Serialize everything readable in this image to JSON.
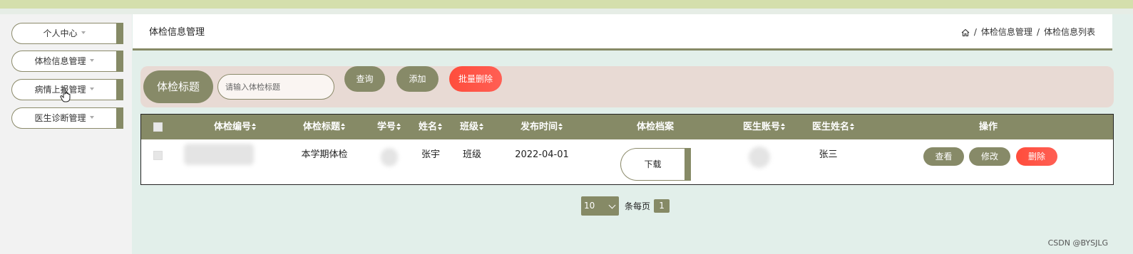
{
  "sidebar": {
    "items": [
      {
        "label": "个人中心"
      },
      {
        "label": "体检信息管理"
      },
      {
        "label": "病情上报管理"
      },
      {
        "label": "医生诊断管理"
      }
    ]
  },
  "header": {
    "title": "体检信息管理",
    "breadcrumb": [
      "体检信息管理",
      "体检信息列表"
    ],
    "breadcrumb_sep": "/"
  },
  "search": {
    "label": "体检标题",
    "placeholder": "请输入体检标题",
    "query_button": "查询",
    "add_button": "添加",
    "batch_delete_button": "批量删除"
  },
  "table": {
    "columns": [
      "体检编号",
      "体检标题",
      "学号",
      "姓名",
      "班级",
      "发布时间",
      "体检档案",
      "医生账号",
      "医生姓名",
      "操作"
    ],
    "rows": [
      {
        "exam_title": "本学期体检",
        "name": "张宇",
        "class": "班级",
        "publish_time": "2022-04-01",
        "file_button": "下载",
        "doctor_name": "张三",
        "actions": {
          "view": "查看",
          "edit": "修改",
          "delete": "删除"
        }
      }
    ]
  },
  "pager": {
    "page_size": "10",
    "per_page_text": "条每页",
    "current_page": "1"
  },
  "watermark": "CSDN @BYSJLG",
  "colors": {
    "olive": "#868a66",
    "danger": "#ff4d3c",
    "search_bg": "#e8dad4",
    "page_bg": "#e2efea"
  }
}
